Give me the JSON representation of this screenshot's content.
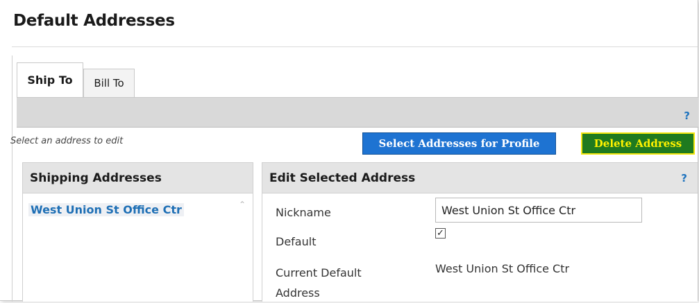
{
  "page": {
    "title": "Default Addresses"
  },
  "tabs": [
    {
      "label": "Ship To",
      "active": true
    },
    {
      "label": "Bill To",
      "active": false
    }
  ],
  "toolbar": {
    "help": "?"
  },
  "hint": "Select an address to edit",
  "buttons": {
    "select_profile": "Select Addresses for Profile",
    "delete": "Delete Address"
  },
  "shipping": {
    "title": "Shipping Addresses",
    "items": [
      "West Union St Office Ctr"
    ]
  },
  "edit": {
    "title": "Edit Selected Address",
    "help": "?",
    "nickname_label": "Nickname",
    "nickname_value": "West Union St Office Ctr",
    "default_label": "Default",
    "default_checked": true,
    "current_label_line1": "Current Default",
    "current_label_line2": "Address",
    "current_value": "West Union St Office Ctr"
  },
  "colors": {
    "select_button_bg": "#1e73d2",
    "delete_button_bg": "#1f7a1f",
    "delete_button_text": "#fff200",
    "link_blue": "#1e6fb5"
  },
  "icons": [
    "help-icon",
    "scroll-up-arrow-icon",
    "checkbox-checked-icon"
  ]
}
